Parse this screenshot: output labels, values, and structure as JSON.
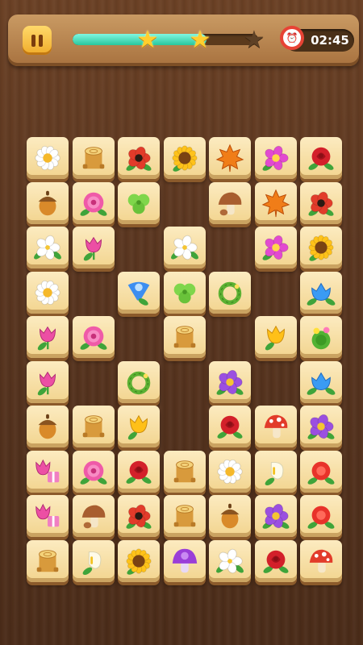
{
  "hud": {
    "pause_icon": "pause-icon",
    "progress": 0.72,
    "stars": [
      {
        "icon": "star-icon",
        "earned": true
      },
      {
        "icon": "star-icon",
        "earned": true
      },
      {
        "icon": "star-icon",
        "earned": false
      }
    ],
    "timer_icon": "alarm-clock-icon",
    "time": "02:45"
  },
  "colors": {
    "tile_face": "#f6dea0",
    "wood_bg": "#5a3620",
    "progress_fill": "#3fd9b0",
    "star_on": "#ffcf2e"
  },
  "board": {
    "rows": [
      [
        "daisy",
        "stump",
        "poppy",
        "sunflower",
        "maple-leaf",
        "pink-blossom",
        "rose"
      ],
      [
        "acorn",
        "peony",
        "clover",
        "",
        "mushroom",
        "maple-leaf",
        "poppy"
      ],
      [
        "white-lily",
        "tulip",
        "",
        "white-lily",
        "",
        "pink-blossom",
        "sunflower"
      ],
      [
        "daisy",
        "",
        "morning-glory",
        "clover",
        "vine-wreath",
        "",
        "blue-flower"
      ],
      [
        "tulip",
        "peony",
        "",
        "stump",
        "",
        "yellow-tulip",
        "cactus-flower"
      ],
      [
        "tulip",
        "",
        "vine-wreath",
        "",
        "violet",
        "",
        "blue-flower"
      ],
      [
        "acorn",
        "stump",
        "yellow-tulip",
        "",
        "rose",
        "red-mushroom",
        "violet"
      ],
      [
        "tulip-gift",
        "peony",
        "rose",
        "stump",
        "daisy",
        "calla-lily",
        "red-flower"
      ],
      [
        "tulip-gift",
        "mushroom",
        "poppy",
        "stump",
        "acorn",
        "violet",
        "red-flower"
      ],
      [
        "stump",
        "calla-lily",
        "sunflower",
        "purple-mushroom",
        "white-lily",
        "rose",
        "red-mushroom"
      ]
    ]
  }
}
